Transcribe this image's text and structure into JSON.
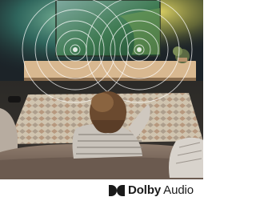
{
  "brand": {
    "name": "Dolby",
    "product": "Audio"
  },
  "scene_elements": {
    "tv": "ambilight-tv-icon",
    "speakers": "sound-wave-icon",
    "viewer": "person-on-sofa",
    "rug": "patterned-rug"
  },
  "colors": {
    "ambilight_green": "#4fc49a",
    "ambilight_yellow": "#e6d247",
    "room_dark": "#1c2328",
    "sofa": "#8a7768",
    "rug": "#cfc2ae",
    "logo_text": "#1a1a1a"
  }
}
